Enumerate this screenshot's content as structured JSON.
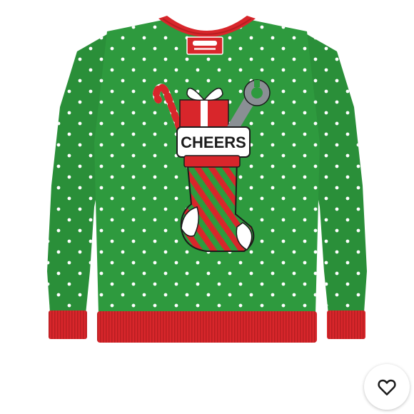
{
  "product": {
    "graphic_text": "CHEERS",
    "colors": {
      "body_green": "#2e9a3e",
      "sleeve_green": "#2a8f39",
      "rib_red": "#d8262b",
      "dot_white": "#ffffff",
      "outline_black": "#1b1b1b",
      "metal_gray": "#8a8f94"
    }
  },
  "like_button": {
    "icon": "heart-outline-icon"
  }
}
